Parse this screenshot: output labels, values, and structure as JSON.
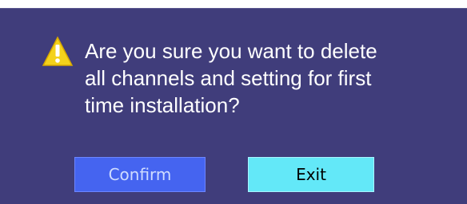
{
  "dialog": {
    "icon": "warning-icon",
    "message": "Are you sure you want to delete\nall channels and setting for first\ntime installation?",
    "buttons": {
      "confirm_label": "Confirm",
      "exit_label": "Exit"
    }
  },
  "colors": {
    "dialog_background": "#403d7b",
    "confirm_button": "#4564f0",
    "exit_button": "#63e8f8",
    "warning_icon": "#f4d21b"
  }
}
